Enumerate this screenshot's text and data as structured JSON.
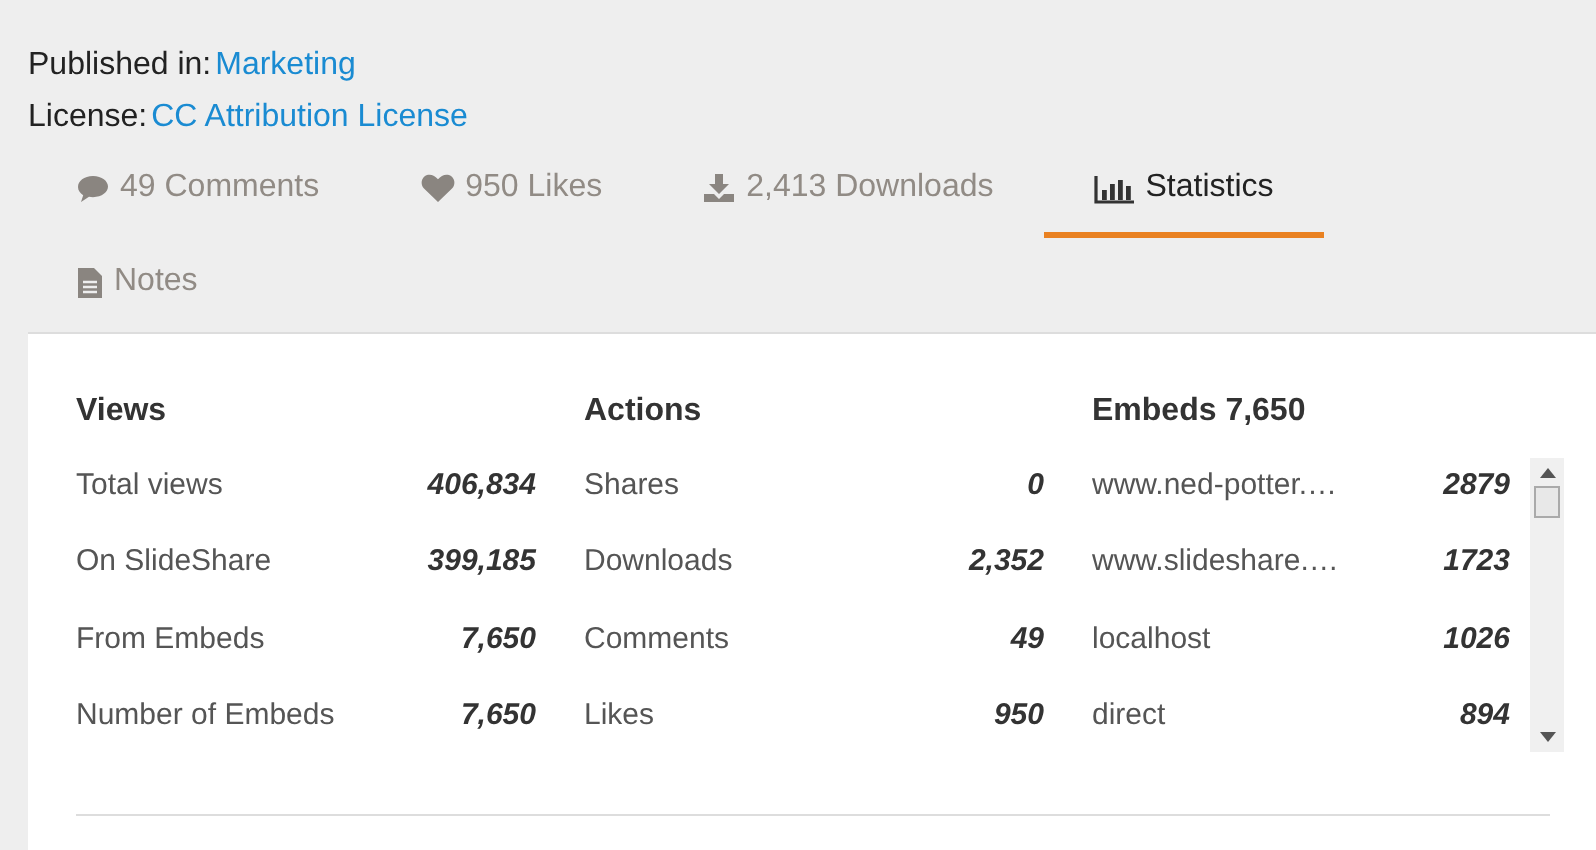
{
  "meta": [
    {
      "label": "Published in:",
      "link": "Marketing"
    },
    {
      "label": "License:",
      "link": "CC Attribution License"
    }
  ],
  "tabs": [
    {
      "kind": "comments",
      "label": "49 Comments",
      "selected": false
    },
    {
      "kind": "likes",
      "label": "950 Likes",
      "selected": false
    },
    {
      "kind": "downloads",
      "label": "2,413 Downloads",
      "selected": false
    },
    {
      "kind": "statistics",
      "label": "Statistics",
      "selected": true
    },
    {
      "kind": "notes",
      "label": "Notes",
      "selected": false
    }
  ],
  "stats": [
    {
      "title": "Views",
      "scrollable": false,
      "rows": [
        {
          "label": "Total views",
          "value": "406,834"
        },
        {
          "label": "On SlideShare",
          "value": "399,185"
        },
        {
          "label": "From Embeds",
          "value": "7,650"
        },
        {
          "label": "Number of Embeds",
          "value": "7,650"
        }
      ]
    },
    {
      "title": "Actions",
      "scrollable": false,
      "rows": [
        {
          "label": "Shares",
          "value": "0"
        },
        {
          "label": "Downloads",
          "value": "2,352"
        },
        {
          "label": "Comments",
          "value": "49"
        },
        {
          "label": "Likes",
          "value": "950"
        }
      ]
    },
    {
      "title": "Embeds 7,650",
      "scrollable": true,
      "rows": [
        {
          "label": "www.ned-potter.…",
          "value": "2879"
        },
        {
          "label": "www.slideshare.…",
          "value": "1723"
        },
        {
          "label": "localhost",
          "value": "1026"
        },
        {
          "label": "direct",
          "value": "894"
        }
      ]
    }
  ]
}
